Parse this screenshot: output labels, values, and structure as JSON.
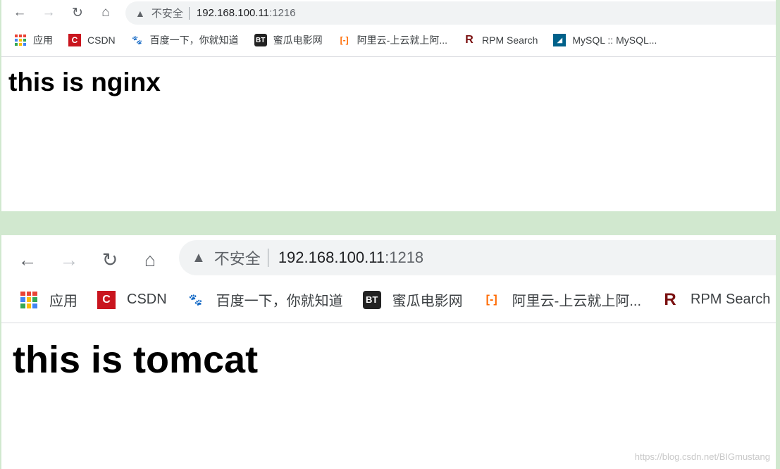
{
  "windows": [
    {
      "url_host": "192.168.100.11",
      "url_port": ":1216",
      "security_label": "不安全",
      "heading": "this is nginx"
    },
    {
      "url_host": "192.168.100.11",
      "url_port": ":1218",
      "security_label": "不安全",
      "heading": "this is tomcat"
    }
  ],
  "bookmarks": [
    {
      "label": "应用",
      "icon": "apps-grid-icon"
    },
    {
      "label": "CSDN",
      "icon": "csdn-icon",
      "color": "#c9151e"
    },
    {
      "label": "百度一下，你就知道",
      "icon": "baidu-paw-icon",
      "color": "#3385ff"
    },
    {
      "label": "蜜瓜电影网",
      "icon": "bt-icon",
      "color": "#222222"
    },
    {
      "label": "阿里云-上云就上阿...",
      "icon": "aliyun-icon",
      "color": "#ff6a00"
    },
    {
      "label": "RPM Search",
      "icon": "rpm-icon",
      "color": "#7a1010"
    },
    {
      "label": "MySQL :: MySQL...",
      "icon": "mysql-icon",
      "color": "#00618a"
    }
  ],
  "watermark": "https://blog.csdn.net/BIGmustang",
  "colors": {
    "background": "#d1e8cf",
    "omnibox": "#f1f3f4"
  }
}
